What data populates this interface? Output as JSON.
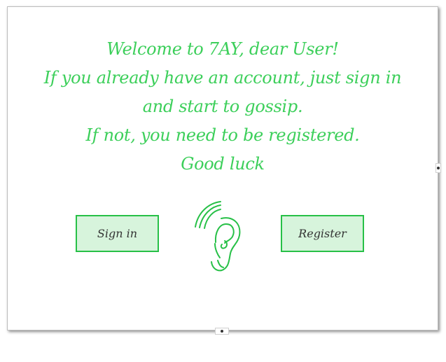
{
  "welcome": {
    "line1": "Welcome to 7AY, dear User!",
    "line2": "If you already have an account, just sign in",
    "line3": "and start to gossip.",
    "line4": "If not, you need to be registered.",
    "line5": "Good luck"
  },
  "buttons": {
    "signin_label": "Sign in",
    "register_label": "Register"
  },
  "logo": {
    "icon": "ear-icon"
  },
  "colors": {
    "accent": "#3ccf5a",
    "button_border": "#27c047",
    "button_fill": "#d7f4dc"
  }
}
